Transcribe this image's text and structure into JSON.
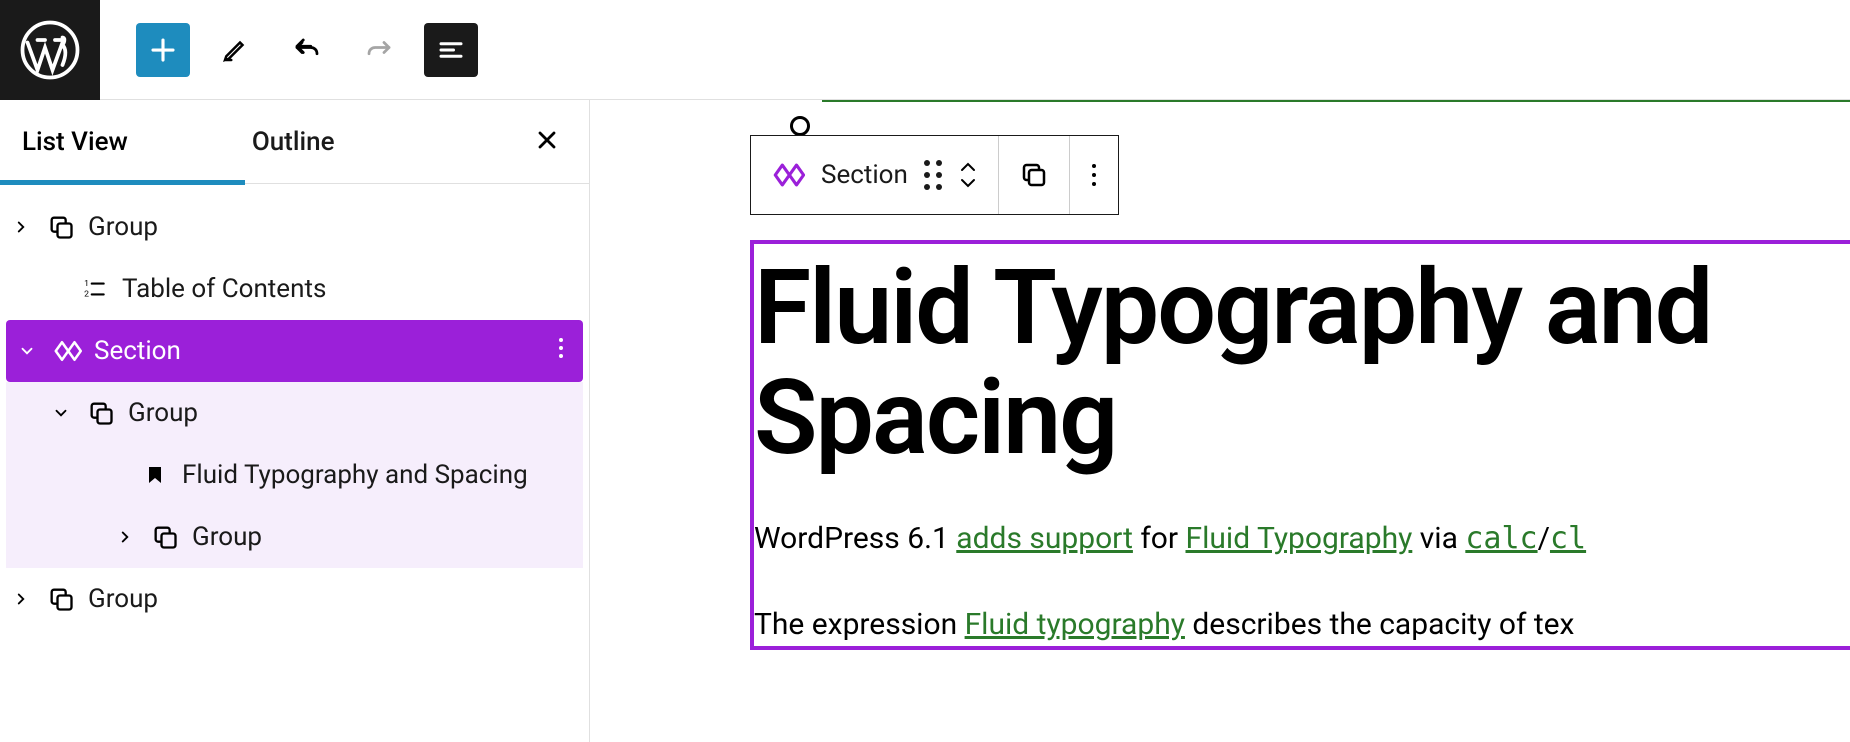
{
  "toolbar": {
    "icons": {
      "logo": "wordpress",
      "add": "plus",
      "edit": "pencil",
      "undo": "undo",
      "redo": "redo",
      "listview": "list-toggle"
    }
  },
  "sidebar": {
    "tabs": {
      "list_view": "List View",
      "outline": "Outline"
    },
    "tree": {
      "group_top": "Group",
      "toc": "Table of Contents",
      "section": "Section",
      "group_in_section": "Group",
      "heading_item": "Fluid Typography and Spacing",
      "group_inner": "Group",
      "group_bottom": "Group"
    }
  },
  "floating": {
    "label": "Section"
  },
  "content": {
    "heading": "Fluid Typography and Spacing",
    "p1_pre": "WordPress 6.1 ",
    "p1_link1": "adds support",
    "p1_mid": " for ",
    "p1_link2": "Fluid Typography",
    "p1_via": " via ",
    "p1_code1": "calc",
    "p1_slash": "/",
    "p1_code2": "cl",
    "p2_pre": "The expression ",
    "p2_link": "Fluid typography",
    "p2_post": " describes the capacity of tex"
  },
  "colors": {
    "brand_blue": "#1e8cbe",
    "selection_purple": "#9b20d9",
    "link_green": "#2a7a2a"
  }
}
